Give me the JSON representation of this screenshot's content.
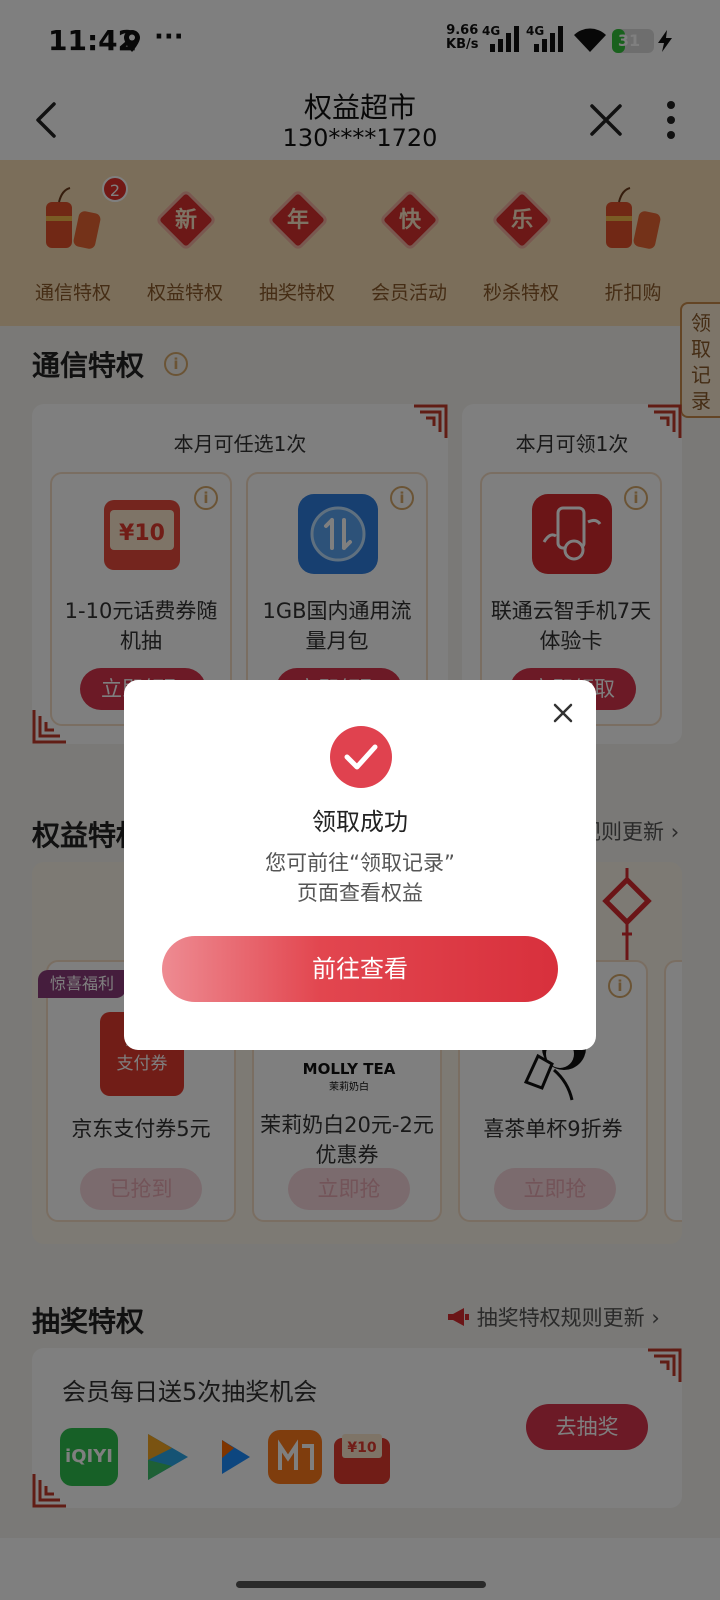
{
  "status_bar": {
    "time": "11:42",
    "dots": "···",
    "speed_value": "9.66",
    "speed_unit": "KB/s",
    "network1": "4G",
    "network2": "4G",
    "battery": "31",
    "battery_level_percent": 31
  },
  "header": {
    "title": "权益超市",
    "subtitle": "130****1720"
  },
  "categories": [
    {
      "label": "通信特权",
      "icon": "firecracker-icon",
      "badge": "2"
    },
    {
      "label": "权益特权",
      "icon": "diamond-icon",
      "char": "新"
    },
    {
      "label": "抽奖特权",
      "icon": "diamond-icon",
      "char": "年"
    },
    {
      "label": "会员活动",
      "icon": "diamond-icon",
      "char": "快"
    },
    {
      "label": "秒杀特权",
      "icon": "diamond-icon",
      "char": "乐"
    },
    {
      "label": "折扣购",
      "icon": "firecracker-icon"
    }
  ],
  "side_tab": "领取记录",
  "telecom": {
    "title": "通信特权",
    "panel1_head": "本月可任选1次",
    "panel2_head": "本月可领1次",
    "cards": [
      {
        "name": "1-10元话费券随机抽",
        "icon": "voucher-icon",
        "icon_text": "¥10",
        "button": "立即领取"
      },
      {
        "name": "1GB国内通用流量月包",
        "icon": "data-traffic-icon",
        "button": "立即领取"
      },
      {
        "name": "联通云智手机7天体验卡",
        "icon": "cloud-phone-icon",
        "button": "立即领取"
      }
    ]
  },
  "benefits": {
    "title": "权益特权",
    "link": "权益特权规则更新",
    "tag": "惊喜福利",
    "cards": [
      {
        "name": "京东支付券5元",
        "icon_text": "京东\n支付券",
        "button": "已抢到"
      },
      {
        "name": "茉莉奶白20元-2元优惠券",
        "logo": "MOLLY TEA",
        "logo_sub": "茉莉奶白",
        "button": "立即抢"
      },
      {
        "name": "喜茶单杯9折券",
        "icon": "heytea-icon",
        "button": "立即抢"
      }
    ]
  },
  "lottery": {
    "title": "抽奖特权",
    "link": "抽奖特权规则更新",
    "text": "会员每日送5次抽奖机会",
    "button": "去抽奖",
    "app_icons": [
      "iqiyi-icon",
      "video-play-icon",
      "youku-icon",
      "mango-tv-icon",
      "voucher-icon"
    ],
    "iqiyi_label": "iQIYI",
    "voucher_label": "¥10"
  },
  "dialog": {
    "title": "领取成功",
    "message_line1": "您可前往“领取记录”",
    "message_line2": "页面查看权益",
    "button": "前往查看"
  },
  "colors": {
    "accent": "#d8344c",
    "header_strip": "#f7dcb4",
    "gold": "#d6a96a"
  }
}
